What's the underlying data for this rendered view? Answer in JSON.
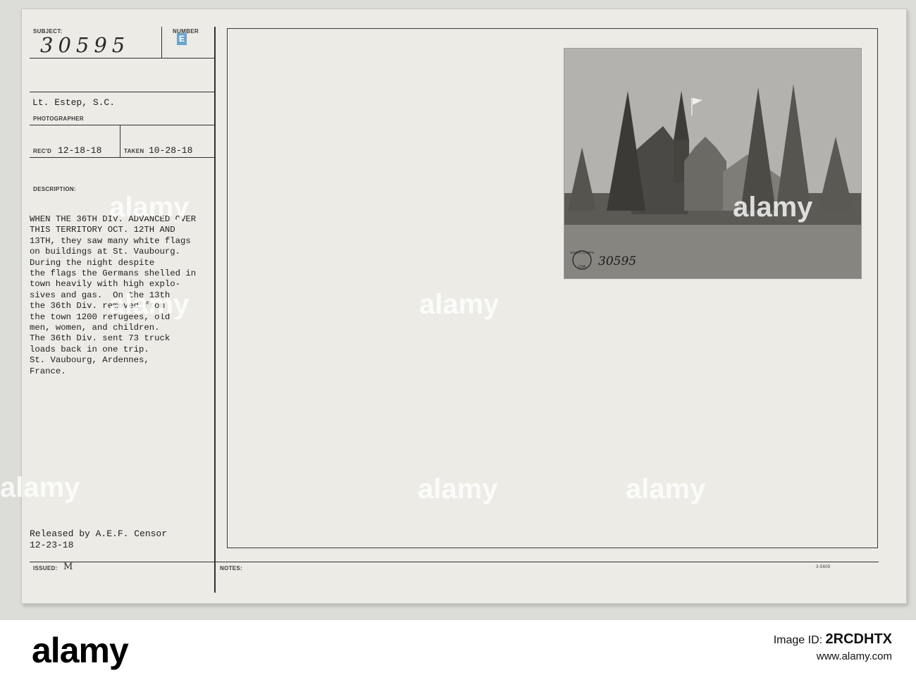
{
  "card": {
    "subject_label": "SUBJECT:",
    "subject_number": "30595",
    "number_label": "NUMBER",
    "number_stamp": "E",
    "photographer_name": "Lt. Estep, S.C.",
    "photographer_label": "PHOTOGRAPHER",
    "recd_label": "REC'D",
    "recd_date": "12-18-18",
    "taken_label": "TAKEN",
    "taken_date": "10-28-18",
    "description_label": "DESCRIPTION:",
    "description_lines": [
      "WHEN THE 36TH DIV. ADVANCED OVER",
      "THIS TERRITORY OCT. 12TH AND",
      "13TH, they saw many white flags",
      "on buildings at St. Vaubourg.",
      "During the night despite",
      "the flags the Germans shelled in",
      "town heavily with high explo-",
      "sives and gas.  On the 13th",
      "the 36th Div. removed from",
      "the town 1200 refugees, old",
      "men, women, and children.",
      "The 36th Div. sent 73 truck",
      "loads back in one trip.",
      "St. Vaubourg, Ardennes,",
      "France."
    ],
    "released_line": "Released by A.E.F. Censor",
    "released_date": "12-23-18",
    "issued_label": "ISSUED:",
    "issued_value": "M",
    "notes_label": "NOTES:",
    "form_number": "3-5605"
  },
  "photo": {
    "handwritten_number": "30595",
    "stamp_top": "SIGNAL CORPS",
    "stamp_bottom": "USA"
  },
  "watermark": {
    "text": "alamy"
  },
  "footer": {
    "logo": "alamy",
    "image_id_label": "Image ID:",
    "image_id": "2RCDHTX",
    "site": "www.alamy.com"
  }
}
